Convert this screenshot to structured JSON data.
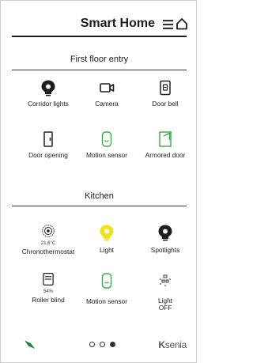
{
  "header": {
    "title": "Smart Home",
    "menu_icon": "menu-icon",
    "home_icon": "home-icon"
  },
  "sections": [
    {
      "title": "First floor entry",
      "tiles": [
        {
          "label": "Corridor lights",
          "icon": "bulb-icon",
          "color": "#1e1e1e"
        },
        {
          "label": "Camera",
          "icon": "camera-icon",
          "color": "#1e1e1e"
        },
        {
          "label": "Door bell",
          "icon": "doorbell-icon",
          "color": "#1e1e1e"
        },
        {
          "label": "Door opening",
          "icon": "door-opening-icon",
          "color": "#1e1e1e"
        },
        {
          "label": "Motion sensor",
          "icon": "motion-sensor-icon",
          "color": "#3aa844"
        },
        {
          "label": "Armored door",
          "icon": "armored-door-icon",
          "color": "#3aa844"
        }
      ]
    },
    {
      "title": "Kitchen",
      "tiles": [
        {
          "label": "Chronothermostat",
          "value": "21,6°C",
          "icon": "thermostat-icon",
          "color": "#1e1e1e"
        },
        {
          "label": "Light",
          "icon": "bulb-icon",
          "color": "#f2e21b"
        },
        {
          "label": "Spotlights",
          "icon": "bulb-icon",
          "color": "#1e1e1e"
        },
        {
          "label": "Roller blind",
          "value": "54%",
          "icon": "roller-blind-icon",
          "color": "#1e1e1e"
        },
        {
          "label": "Motion sensor",
          "icon": "motion-sensor-icon",
          "color": "#3aa844"
        },
        {
          "label": "Light\nOFF",
          "label_line1": "Light",
          "label_line2": "OFF",
          "icon": "light-off-icon",
          "color": "#1e1e1e"
        }
      ]
    }
  ],
  "footer": {
    "pages": 3,
    "active_page": 3,
    "leaf_icon": "leaf-icon",
    "brand_k": "K",
    "brand_rest": "senia",
    "accent_green": "#1a8a3a"
  }
}
